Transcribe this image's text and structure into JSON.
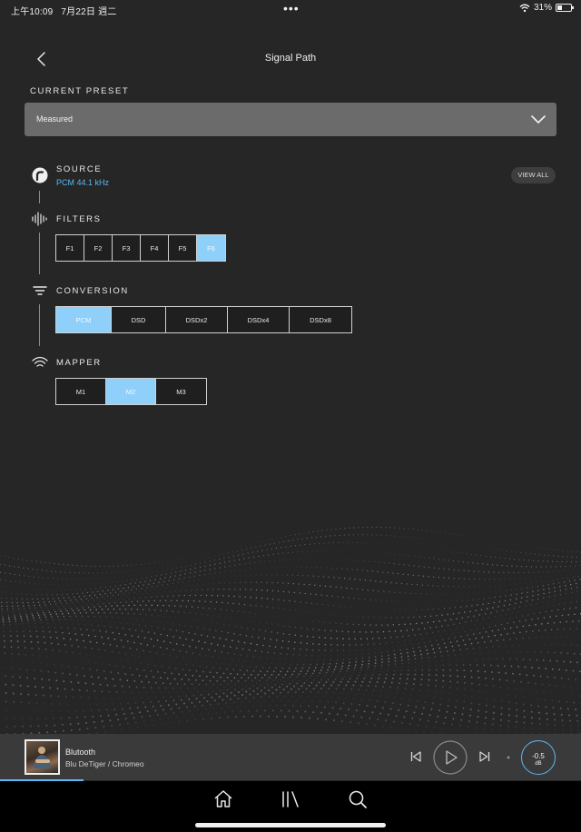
{
  "status_bar": {
    "time": "上午10:09",
    "date": "7月22日 週二",
    "dots": "•••",
    "battery_pct": "31%"
  },
  "header": {
    "title": "Signal Path"
  },
  "preset": {
    "label": "CURRENT PRESET",
    "value": "Measured"
  },
  "source": {
    "label": "SOURCE",
    "value": "PCM 44.1 kHz",
    "view_all": "VIEW ALL"
  },
  "filters": {
    "label": "FILTERS",
    "options": [
      "F1",
      "F2",
      "F3",
      "F4",
      "F5",
      "F6"
    ],
    "selected": "F6"
  },
  "conversion": {
    "label": "CONVERSION",
    "options": [
      "PCM",
      "DSD",
      "DSDx2",
      "DSDx4",
      "DSDx8"
    ],
    "selected": "PCM"
  },
  "mapper": {
    "label": "MAPPER",
    "options": [
      "M1",
      "M2",
      "M3"
    ],
    "selected": "M2"
  },
  "now_playing": {
    "title": "Blutooth",
    "subtitle": "Blu DeTiger / Chromeo",
    "volume": "-0.5",
    "volume_unit": "dB"
  },
  "icons": {
    "back": "chevron-left-icon",
    "dropdown": "chevron-down-icon",
    "source": "source-icon",
    "filters": "waveform-icon",
    "conversion": "lines-icon",
    "mapper": "wifi-icon",
    "prev": "skip-previous-icon",
    "play": "play-icon",
    "next": "skip-next-icon",
    "home": "home-icon",
    "library": "library-icon",
    "search": "search-icon"
  },
  "colors": {
    "background": "#262626",
    "accent": "#5cb8f5",
    "active_segment": "#8fd0fb",
    "dropdown_bg": "#6b6b6b",
    "player_bg": "#3a3a3a"
  }
}
